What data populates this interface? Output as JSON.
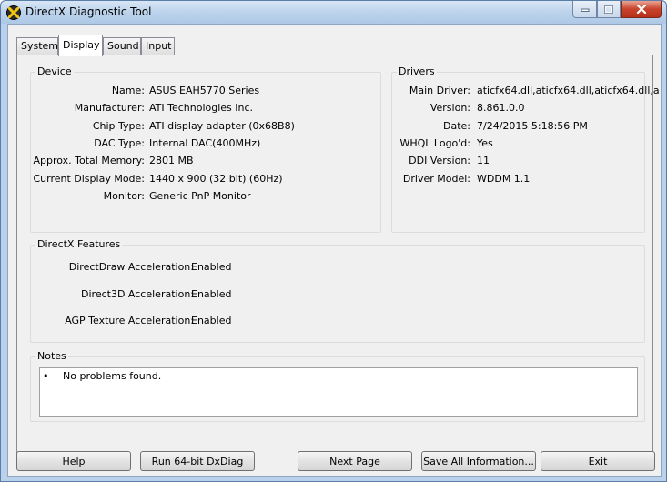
{
  "window": {
    "title": "DirectX Diagnostic Tool"
  },
  "tabs": [
    {
      "label": "System"
    },
    {
      "label": "Display"
    },
    {
      "label": "Sound"
    },
    {
      "label": "Input"
    }
  ],
  "device": {
    "title": "Device",
    "rows": [
      {
        "label": "Name:",
        "value": "ASUS EAH5770 Series"
      },
      {
        "label": "Manufacturer:",
        "value": "ATI Technologies Inc."
      },
      {
        "label": "Chip Type:",
        "value": "ATI display adapter (0x68B8)"
      },
      {
        "label": "DAC Type:",
        "value": "Internal DAC(400MHz)"
      },
      {
        "label": "Approx. Total Memory:",
        "value": "2801 MB"
      },
      {
        "label": "Current Display Mode:",
        "value": "1440 x 900 (32 bit) (60Hz)"
      },
      {
        "label": "Monitor:",
        "value": "Generic PnP Monitor"
      }
    ]
  },
  "drivers": {
    "title": "Drivers",
    "rows": [
      {
        "label": "Main Driver:",
        "value": "aticfx64.dll,aticfx64.dll,aticfx64.dll,a"
      },
      {
        "label": "Version:",
        "value": "8.861.0.0"
      },
      {
        "label": "Date:",
        "value": "7/24/2015 5:18:56 PM"
      },
      {
        "label": "WHQL Logo'd:",
        "value": "Yes"
      },
      {
        "label": "DDI Version:",
        "value": "11"
      },
      {
        "label": "Driver Model:",
        "value": "WDDM 1.1"
      }
    ]
  },
  "features": {
    "title": "DirectX Features",
    "rows": [
      {
        "label": "DirectDraw Acceleration:",
        "value": "Enabled"
      },
      {
        "label": "Direct3D Acceleration:",
        "value": "Enabled"
      },
      {
        "label": "AGP Texture Acceleration:",
        "value": "Enabled"
      }
    ]
  },
  "notes": {
    "title": "Notes",
    "bullet": "•",
    "items": [
      "No problems found."
    ]
  },
  "buttons": {
    "help": "Help",
    "run64": "Run 64-bit DxDiag",
    "next": "Next Page",
    "save": "Save All Information...",
    "exit": "Exit"
  },
  "colors": {
    "frame": "#b9d1ea",
    "panel": "#f0f0f0",
    "close_button": "#c7432c"
  },
  "icons": {
    "app": "directx-logo-icon",
    "minimize": "minimize-icon",
    "maximize": "maximize-icon",
    "close": "close-icon"
  }
}
